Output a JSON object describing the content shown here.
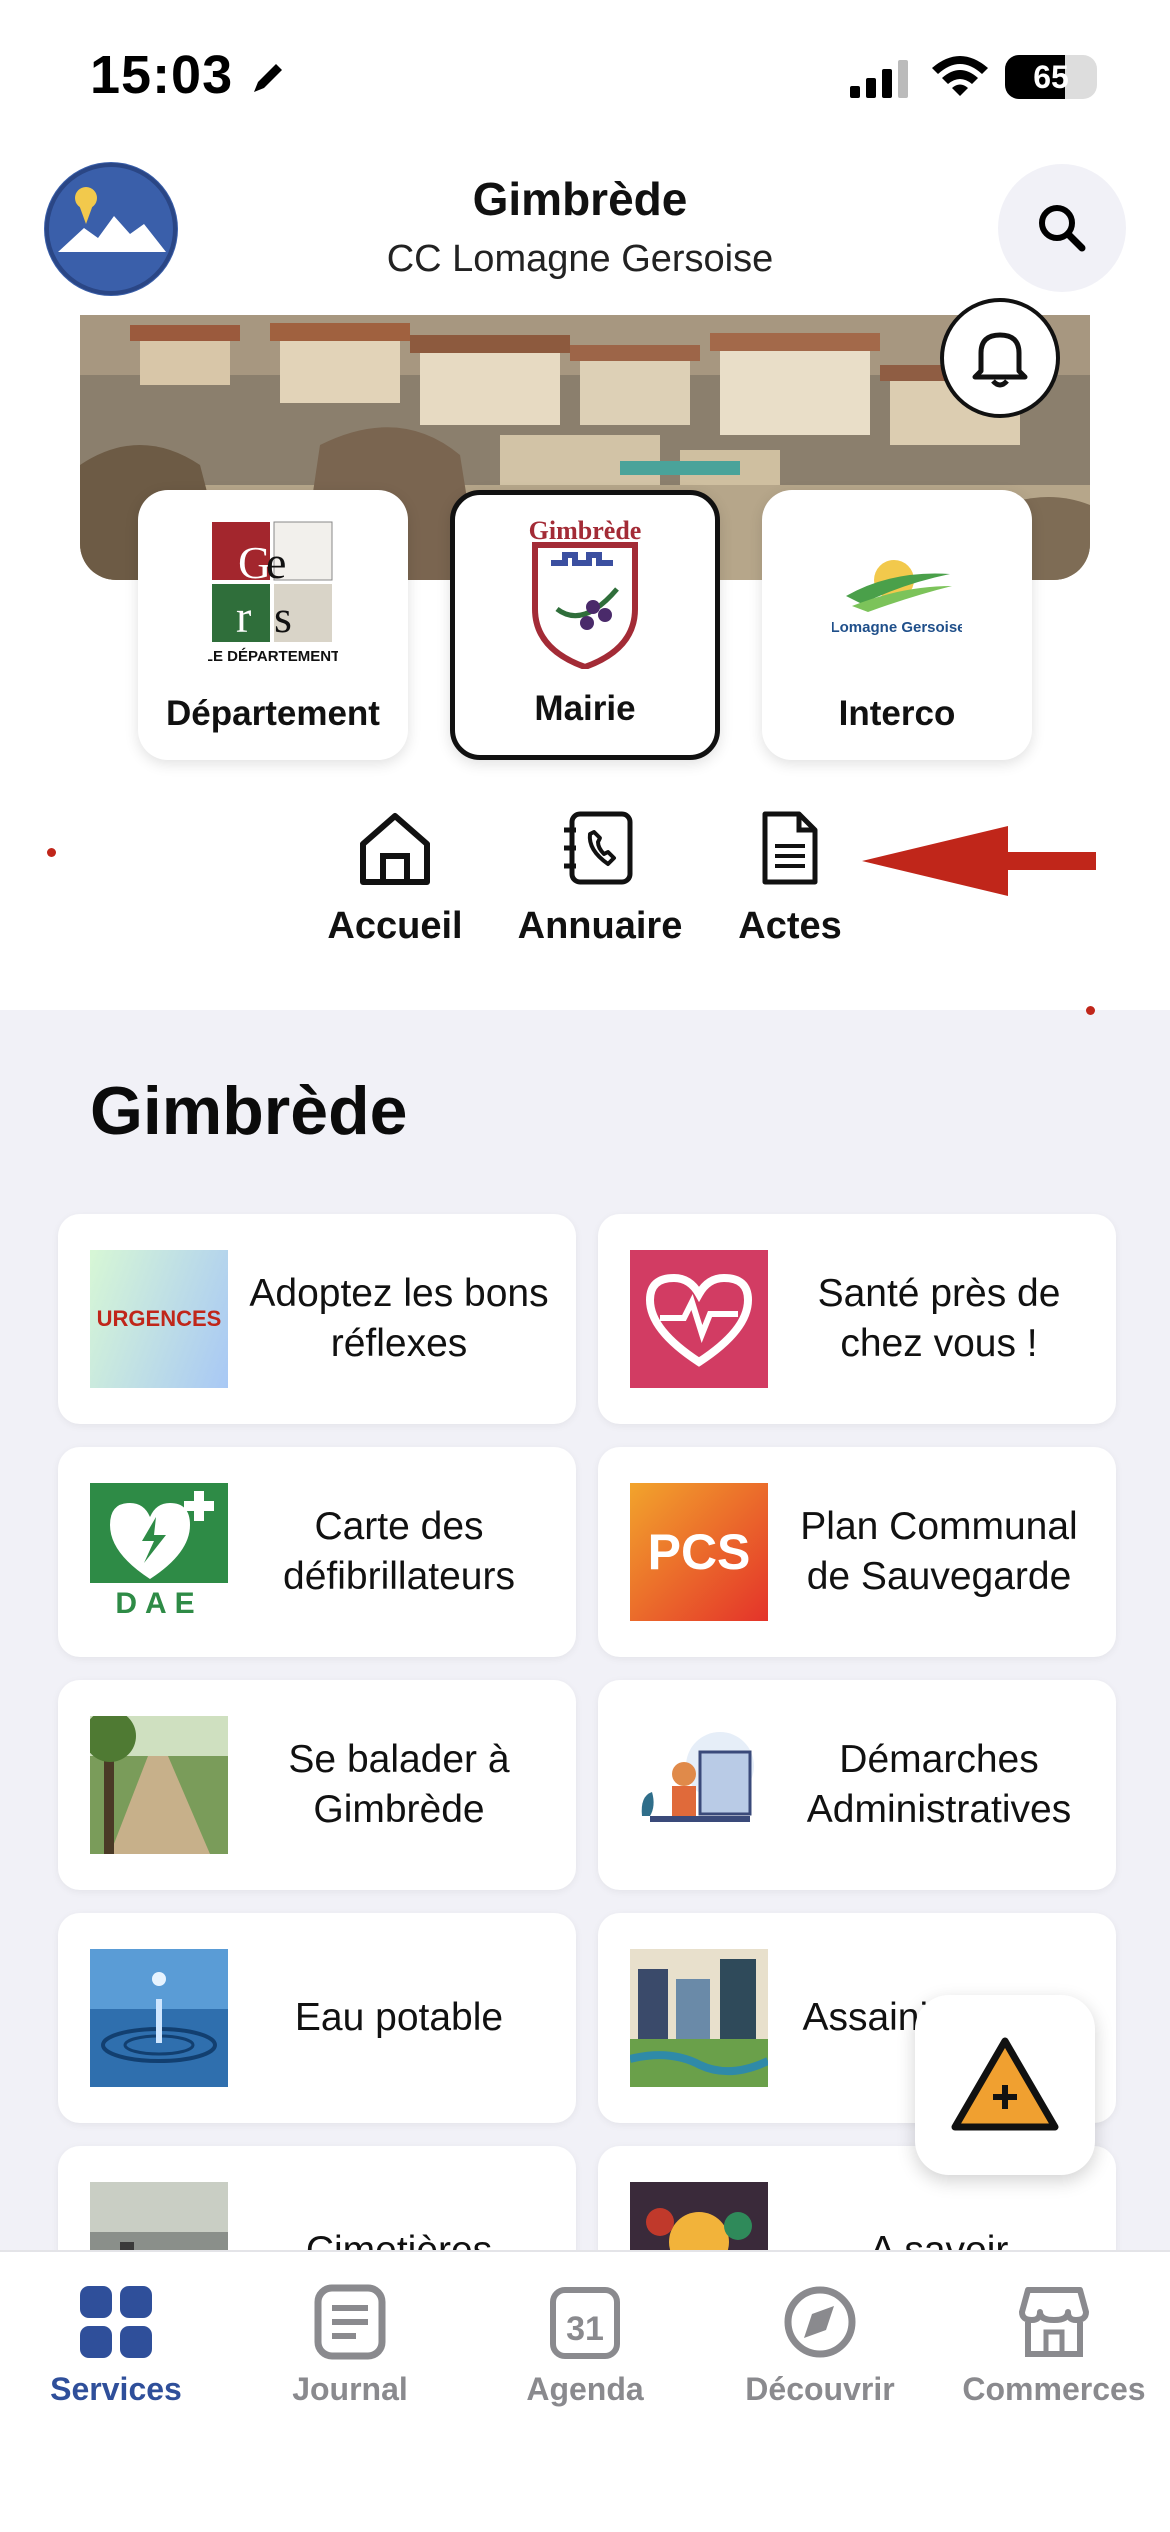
{
  "status": {
    "time": "15:03",
    "battery": "65",
    "battery_level": 0.65
  },
  "header": {
    "title": "Gimbrède",
    "subtitle": "CC Lomagne Gersoise"
  },
  "cards": [
    {
      "label": "Département",
      "logo_text": "LE DÉPARTEMENT",
      "logo_letters": [
        "G",
        "e",
        "r",
        "s"
      ]
    },
    {
      "label": "Mairie",
      "logo_text": "Gimbrède"
    },
    {
      "label": "Interco",
      "logo_text": "Lomagne Gersoise"
    }
  ],
  "nav": [
    {
      "label": "Accueil",
      "icon": "home-icon"
    },
    {
      "label": "Annuaire",
      "icon": "phone-book-icon"
    },
    {
      "label": "Actes",
      "icon": "document-icon"
    }
  ],
  "section": {
    "title": "Gimbrède"
  },
  "tiles": [
    {
      "label": "Adoptez les bons réflexes",
      "thumb_text": "URGENCES"
    },
    {
      "label": "Santé près de chez vous !",
      "thumb_icon": "heart-pulse-icon"
    },
    {
      "label": "Carte des défibrillateurs",
      "thumb_text": "DAE"
    },
    {
      "label": "Plan Communal de Sauvegarde",
      "thumb_text": "PCS"
    },
    {
      "label": "Se balader à Gimbrède",
      "thumb_icon": "path-photo"
    },
    {
      "label": "Démarches Administratives",
      "thumb_icon": "admin-illustration"
    },
    {
      "label": "Eau potable",
      "thumb_icon": "water-drop-photo"
    },
    {
      "label": "Assainissement",
      "thumb_icon": "sanitation-illustration"
    },
    {
      "label": "Cimetières",
      "thumb_icon": "cemetery-photo"
    },
    {
      "label": "A savoir",
      "thumb_icon": "lightbulb-illustration"
    }
  ],
  "tabs": [
    {
      "label": "Services",
      "icon": "grid-icon",
      "active": true
    },
    {
      "label": "Journal",
      "icon": "newspaper-icon"
    },
    {
      "label": "Agenda",
      "icon": "calendar-icon",
      "badge": "31"
    },
    {
      "label": "Découvrir",
      "icon": "compass-icon"
    },
    {
      "label": "Commerces",
      "icon": "store-icon"
    }
  ],
  "colors": {
    "accent": "#2f4f9a",
    "arrow": "#c0261a",
    "fab": "#f0a030"
  }
}
